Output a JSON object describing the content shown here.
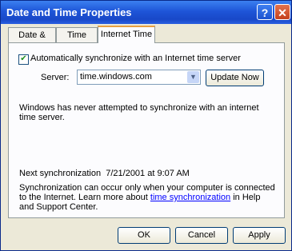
{
  "window": {
    "title": "Date and Time Properties",
    "help_label": "?",
    "close_label": "✕"
  },
  "tabs": [
    {
      "label": "Date & Time"
    },
    {
      "label": "Time Zone"
    },
    {
      "label": "Internet Time"
    }
  ],
  "sync": {
    "checkbox_checked": true,
    "checkbox_label": "Automatically synchronize with an Internet time server",
    "server_label": "Server:",
    "server_value": "time.windows.com",
    "update_button": "Update Now"
  },
  "status_message": "Windows has never attempted to synchronize with an internet time server.",
  "next_sync": {
    "label": "Next synchronization",
    "date": "7/21/2001",
    "time": "at 9:07 AM"
  },
  "info": {
    "text_before": "Synchronization can occur only when your computer is connected to the Internet.  Learn more about ",
    "link_text": "time synchronization",
    "text_after": " in Help and Support Center."
  },
  "buttons": {
    "ok": "OK",
    "cancel": "Cancel",
    "apply": "Apply"
  }
}
